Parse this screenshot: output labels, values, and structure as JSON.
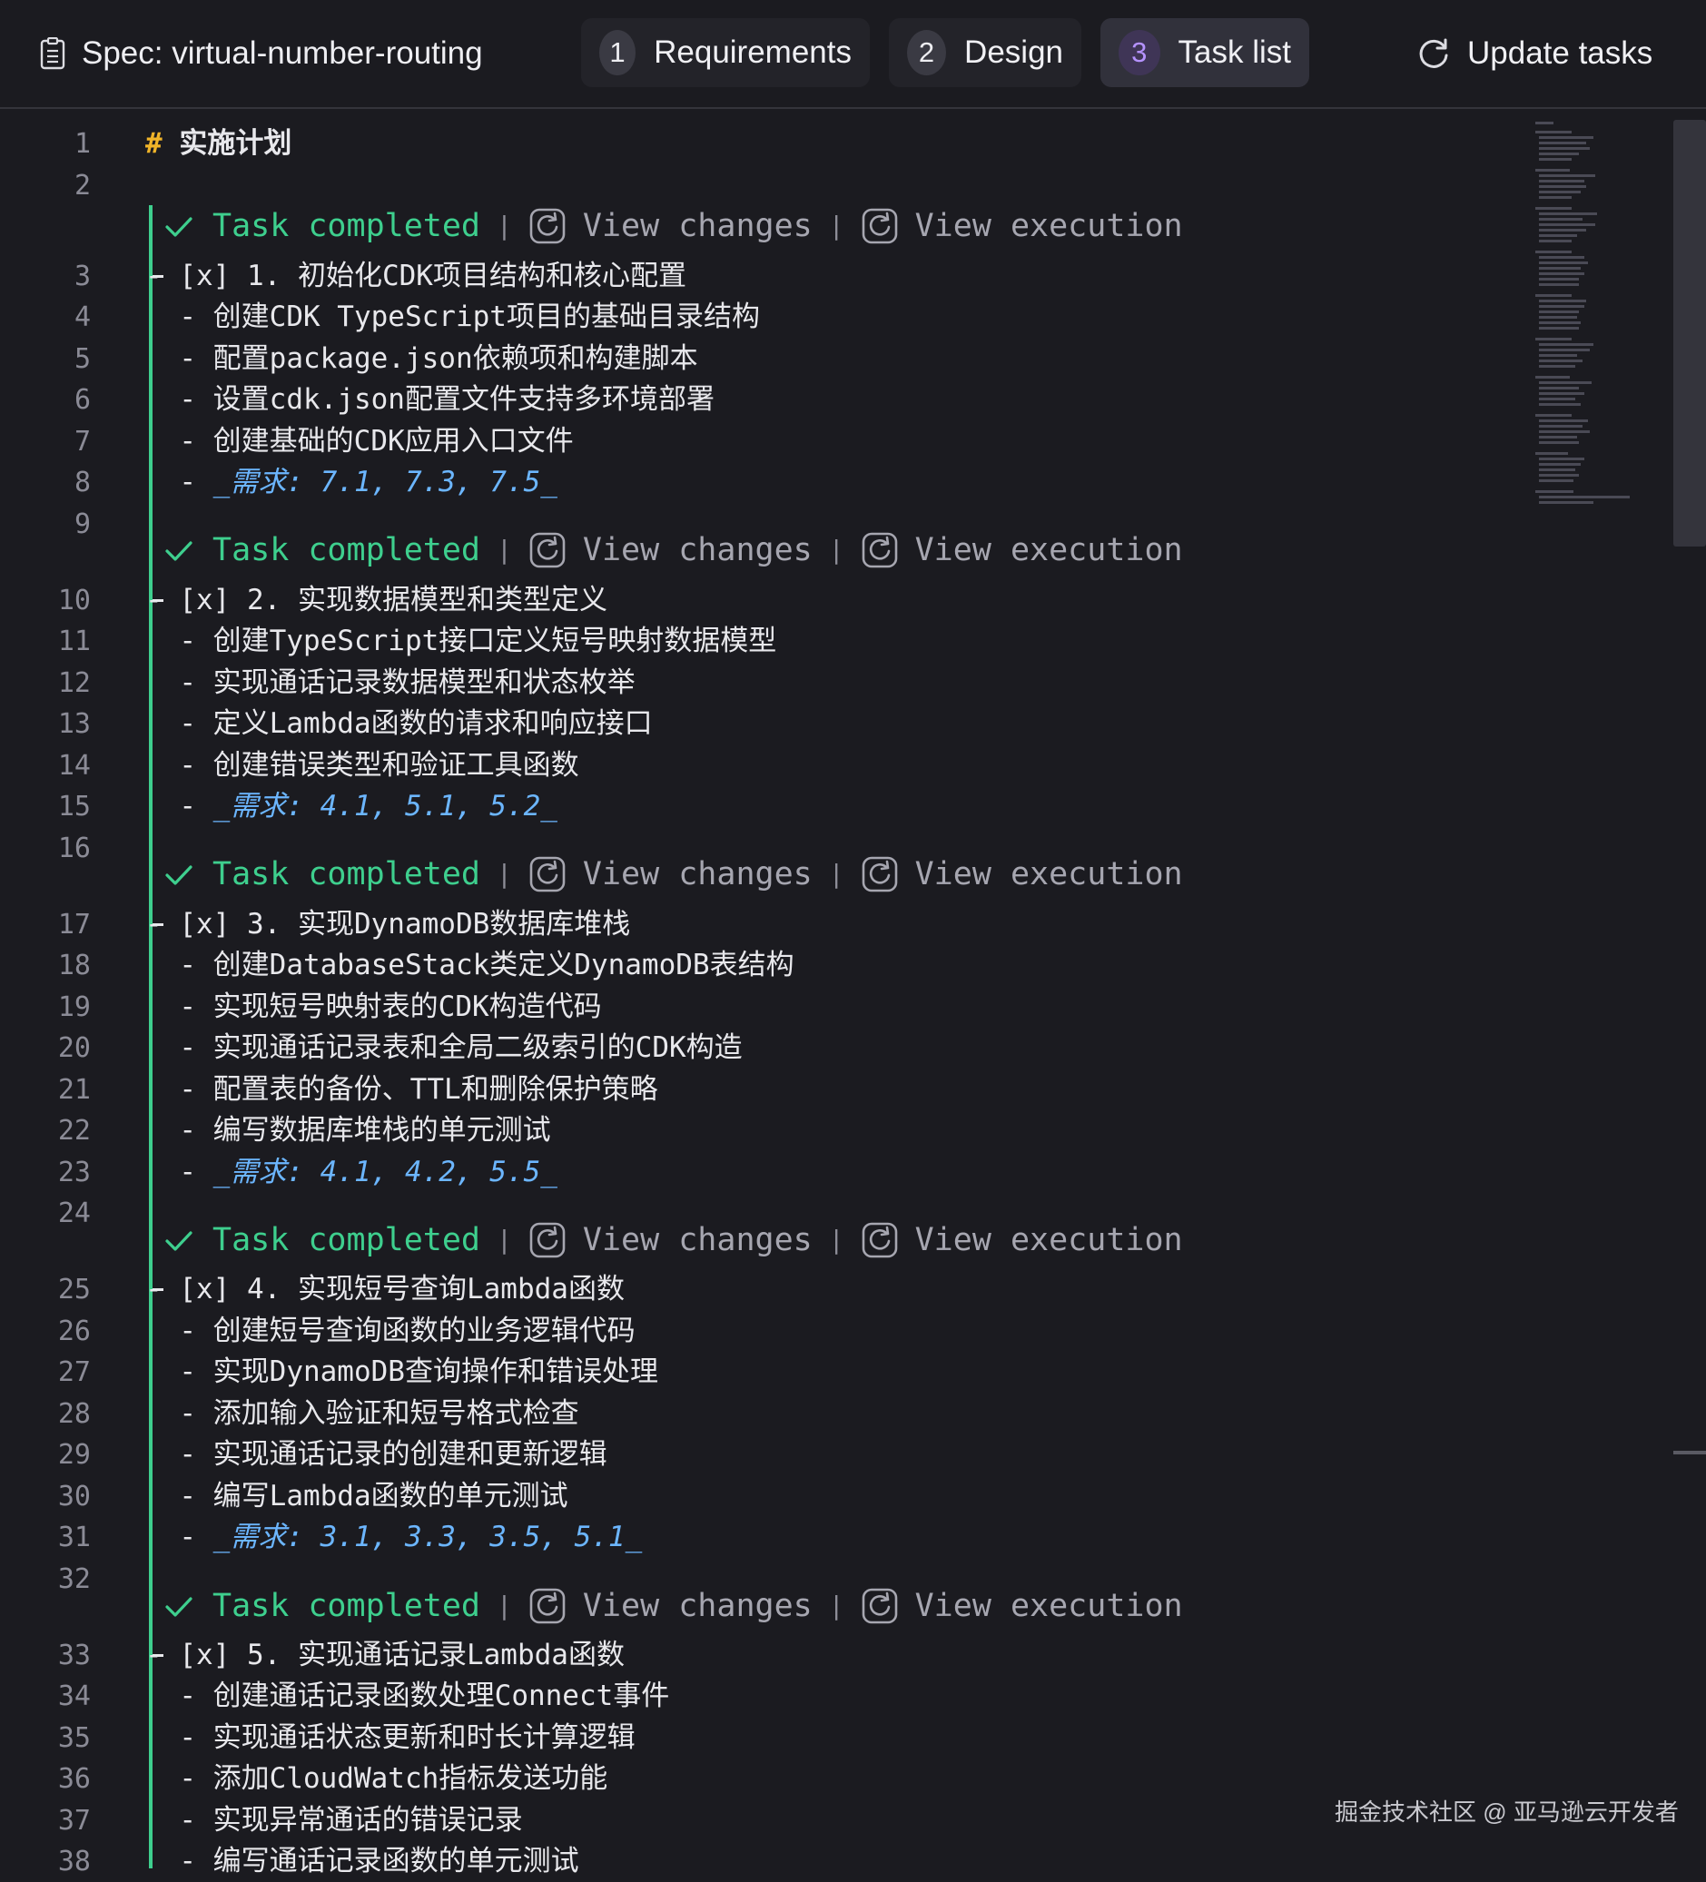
{
  "header": {
    "spec_title": "Spec: virtual-number-routing",
    "tabs": [
      {
        "num": "1",
        "label": "Requirements"
      },
      {
        "num": "2",
        "label": "Design"
      },
      {
        "num": "3",
        "label": "Task list",
        "active": true
      }
    ],
    "update_label": "Update tasks"
  },
  "codelens": {
    "status": "Task completed",
    "separator": "|",
    "view_changes": "View changes",
    "view_execution": "View execution"
  },
  "lines": [
    {
      "n": "1",
      "hash": "#",
      "text": "实施计划"
    },
    {
      "n": "2",
      "text": ""
    },
    {
      "n": "3",
      "text": "- [x] 1. 初始化CDK项目结构和核心配置"
    },
    {
      "n": "4",
      "text": "  - 创建CDK TypeScript项目的基础目录结构"
    },
    {
      "n": "5",
      "text": "  - 配置package.json依赖项和构建脚本"
    },
    {
      "n": "6",
      "text": "  - 设置cdk.json配置文件支持多环境部署"
    },
    {
      "n": "7",
      "text": "  - 创建基础的CDK应用入口文件"
    },
    {
      "n": "8",
      "text": "  - ",
      "req": "_需求: 7.1, 7.3, 7.5_"
    },
    {
      "n": "9",
      "text": ""
    },
    {
      "n": "10",
      "text": "- [x] 2. 实现数据模型和类型定义"
    },
    {
      "n": "11",
      "text": "  - 创建TypeScript接口定义短号映射数据模型"
    },
    {
      "n": "12",
      "text": "  - 实现通话记录数据模型和状态枚举"
    },
    {
      "n": "13",
      "text": "  - 定义Lambda函数的请求和响应接口"
    },
    {
      "n": "14",
      "text": "  - 创建错误类型和验证工具函数"
    },
    {
      "n": "15",
      "text": "  - ",
      "req": "_需求: 4.1, 5.1, 5.2_"
    },
    {
      "n": "16",
      "text": ""
    },
    {
      "n": "17",
      "text": "- [x] 3. 实现DynamoDB数据库堆栈"
    },
    {
      "n": "18",
      "text": "  - 创建DatabaseStack类定义DynamoDB表结构"
    },
    {
      "n": "19",
      "text": "  - 实现短号映射表的CDK构造代码"
    },
    {
      "n": "20",
      "text": "  - 实现通话记录表和全局二级索引的CDK构造"
    },
    {
      "n": "21",
      "text": "  - 配置表的备份、TTL和删除保护策略"
    },
    {
      "n": "22",
      "text": "  - 编写数据库堆栈的单元测试"
    },
    {
      "n": "23",
      "text": "  - ",
      "req": "_需求: 4.1, 4.2, 5.5_"
    },
    {
      "n": "24",
      "text": ""
    },
    {
      "n": "25",
      "text": "- [x] 4. 实现短号查询Lambda函数"
    },
    {
      "n": "26",
      "text": "  - 创建短号查询函数的业务逻辑代码"
    },
    {
      "n": "27",
      "text": "  - 实现DynamoDB查询操作和错误处理"
    },
    {
      "n": "28",
      "text": "  - 添加输入验证和短号格式检查"
    },
    {
      "n": "29",
      "text": "  - 实现通话记录的创建和更新逻辑"
    },
    {
      "n": "30",
      "text": "  - 编写Lambda函数的单元测试"
    },
    {
      "n": "31",
      "text": "  - ",
      "req": "_需求: 3.1, 3.3, 3.5, 5.1_"
    },
    {
      "n": "32",
      "text": ""
    },
    {
      "n": "33",
      "text": "- [x] 5. 实现通话记录Lambda函数"
    },
    {
      "n": "34",
      "text": "  - 创建通话记录函数处理Connect事件"
    },
    {
      "n": "35",
      "text": "  - 实现通话状态更新和时长计算逻辑"
    },
    {
      "n": "36",
      "text": "  - 添加CloudWatch指标发送功能"
    },
    {
      "n": "37",
      "text": "  - 实现异常通话的错误记录"
    },
    {
      "n": "38",
      "text": "  - 编写通话记录函数的单元测试"
    }
  ],
  "watermark": "掘金技术社区 @ 亚马逊云开发者"
}
